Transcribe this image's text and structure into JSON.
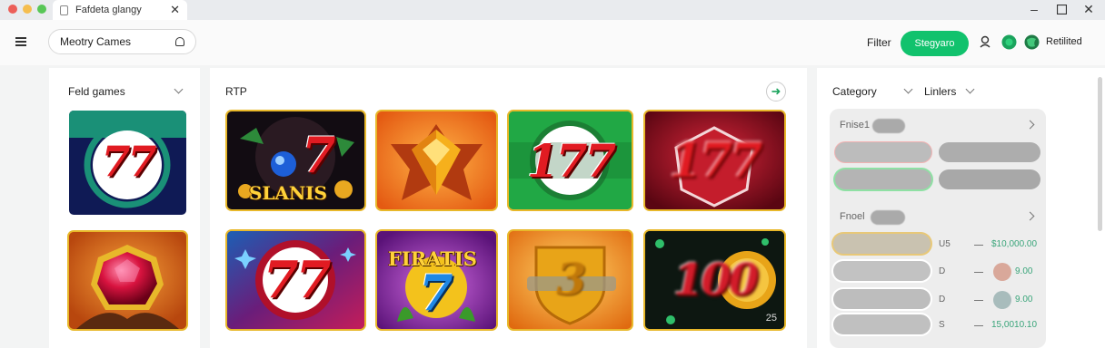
{
  "browser": {
    "tab_title": "Fafdeta glangy",
    "window_controls": [
      "minimize-icon",
      "maximize-icon",
      "close-icon"
    ]
  },
  "header": {
    "search_text": "Meotry Cames",
    "filter_label": "Filter",
    "cta_label": "Stegyaro",
    "user_label": "Retilited",
    "accent": "#11c26d"
  },
  "left_panel": {
    "title": "Feld games",
    "tiles": [
      {
        "name": "77",
        "label": "77"
      },
      {
        "name": "ruby",
        "label": ""
      }
    ]
  },
  "middle_panel": {
    "title": "RTP",
    "tiles": [
      {
        "label": "SLANIS",
        "number": "7"
      },
      {
        "label": "",
        "number": ""
      },
      {
        "label": "",
        "number": "177"
      },
      {
        "label": "",
        "number": "177"
      },
      {
        "label": "",
        "number": "77"
      },
      {
        "label": "FIRATIS",
        "number": "7"
      },
      {
        "label": "",
        "number": "3"
      },
      {
        "label": "",
        "number": "100",
        "corner": "25"
      }
    ]
  },
  "right_panel": {
    "category_label": "Category",
    "limits_label": "Linlers",
    "section1_label": "Fnise1",
    "section2_label": "Fnoel",
    "rows": [
      {
        "code": "U5",
        "amount": "$10,000.00"
      },
      {
        "code": "D",
        "amount": "9.00"
      },
      {
        "code": "D",
        "amount": "9.00"
      },
      {
        "code": "S",
        "amount": "15,0010.10"
      }
    ]
  }
}
